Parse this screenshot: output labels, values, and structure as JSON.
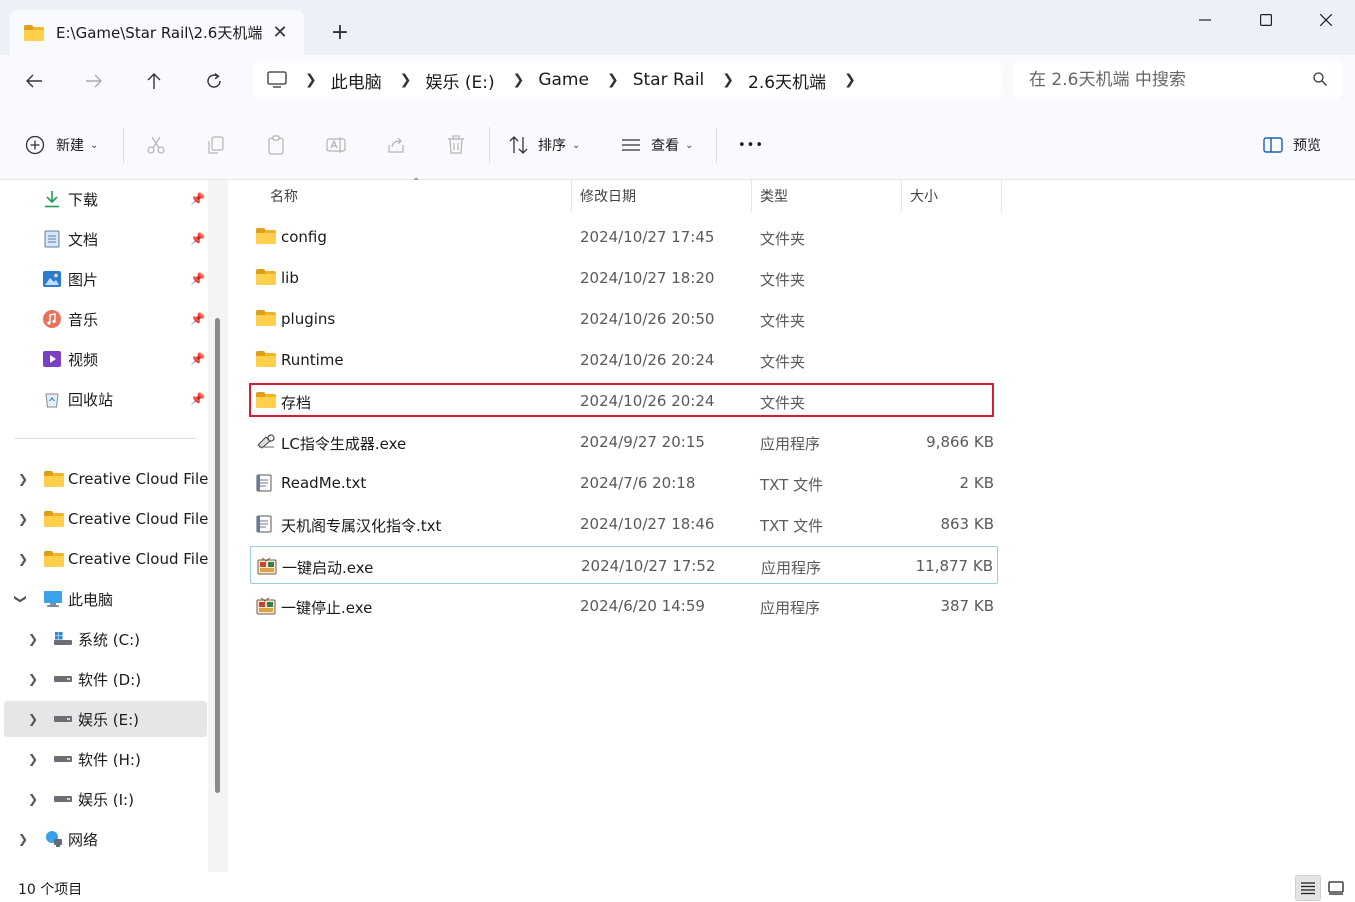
{
  "window": {
    "tab_title": "E:\\Game\\Star Rail\\2.6天机端",
    "tab_close": "✕",
    "new_tab": "+"
  },
  "breadcrumb": [
    "此电脑",
    "娱乐 (E:)",
    "Game",
    "Star Rail",
    "2.6天机端"
  ],
  "search": {
    "placeholder": "在 2.6天机端 中搜索"
  },
  "toolbar": {
    "new_label": "新建",
    "sort_label": "排序",
    "view_label": "查看",
    "more_label": "•••",
    "preview_label": "预览"
  },
  "sidebar": {
    "quick_access": [
      {
        "label": "下载",
        "icon": "download-icon"
      },
      {
        "label": "文档",
        "icon": "document-icon"
      },
      {
        "label": "图片",
        "icon": "pictures-icon"
      },
      {
        "label": "音乐",
        "icon": "music-icon"
      },
      {
        "label": "视频",
        "icon": "video-icon"
      },
      {
        "label": "回收站",
        "icon": "recycle-bin-icon"
      }
    ],
    "cloud": [
      {
        "label": "Creative Cloud Files"
      },
      {
        "label": "Creative Cloud Files"
      },
      {
        "label": "Creative Cloud Files"
      }
    ],
    "this_pc": "此电脑",
    "drives": [
      {
        "label": "系统 (C:)"
      },
      {
        "label": "软件 (D:)"
      },
      {
        "label": "娱乐 (E:)",
        "selected": true
      },
      {
        "label": "软件 (H:)"
      },
      {
        "label": "娱乐 (I:)"
      }
    ],
    "network": "网络"
  },
  "columns": {
    "name": "名称",
    "date": "修改日期",
    "type": "类型",
    "size": "大小"
  },
  "files": [
    {
      "name": "config",
      "date": "2024/10/27 17:45",
      "type": "文件夹",
      "size": "",
      "kind": "folder"
    },
    {
      "name": "lib",
      "date": "2024/10/27 18:20",
      "type": "文件夹",
      "size": "",
      "kind": "folder"
    },
    {
      "name": "plugins",
      "date": "2024/10/26 20:50",
      "type": "文件夹",
      "size": "",
      "kind": "folder"
    },
    {
      "name": "Runtime",
      "date": "2024/10/26 20:24",
      "type": "文件夹",
      "size": "",
      "kind": "folder"
    },
    {
      "name": "存档",
      "date": "2024/10/26 20:24",
      "type": "文件夹",
      "size": "",
      "kind": "folder"
    },
    {
      "name": "LC指令生成器.exe",
      "date": "2024/9/27 20:15",
      "type": "应用程序",
      "size": "9,866 KB",
      "kind": "exe-tool"
    },
    {
      "name": "ReadMe.txt",
      "date": "2024/7/6 20:18",
      "type": "TXT 文件",
      "size": "2 KB",
      "kind": "txt"
    },
    {
      "name": "天机阁专属汉化指令.txt",
      "date": "2024/10/27 18:46",
      "type": "TXT 文件",
      "size": "863 KB",
      "kind": "txt"
    },
    {
      "name": "一键启动.exe",
      "date": "2024/10/27 17:52",
      "type": "应用程序",
      "size": "11,877 KB",
      "kind": "exe-app"
    },
    {
      "name": "一键停止.exe",
      "date": "2024/6/20 14:59",
      "type": "应用程序",
      "size": "387 KB",
      "kind": "exe-app"
    }
  ],
  "status": {
    "item_count": "10 个项目"
  },
  "colors": {
    "highlight": "#d32030",
    "hover_border": "#9ecfe0",
    "folder": "#ffd04d"
  }
}
